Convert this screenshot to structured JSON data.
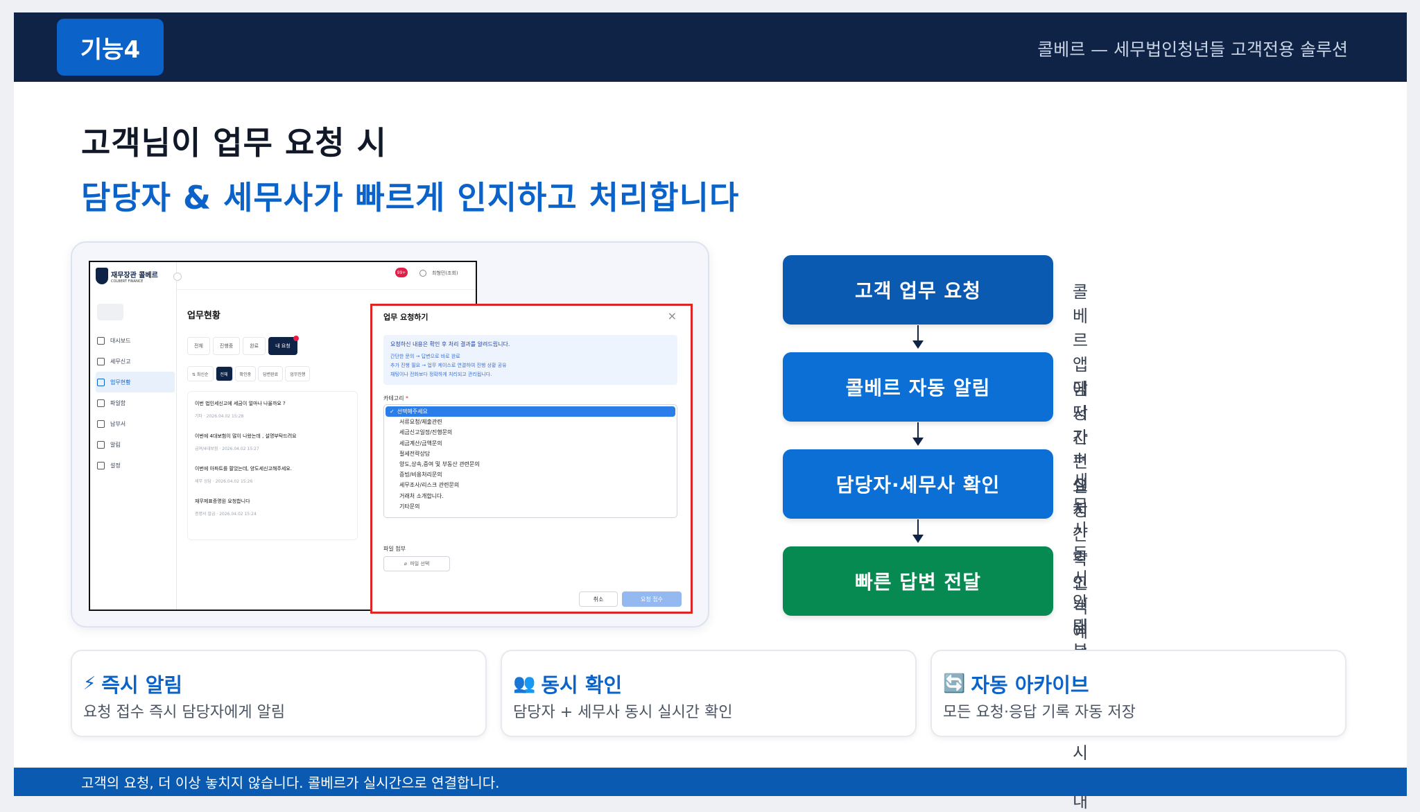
{
  "header": {
    "badge": "기능4",
    "caption": "콜베르 — 세무법인청년들 고객전용 솔루션"
  },
  "headline": {
    "line1": "고객님이 업무 요청 시",
    "line2": "담당자 & 세무사가 빠르게 인지하고 처리합니다"
  },
  "app": {
    "logo_name": "재무장관 콜베르",
    "logo_sub": "COLBERT FINANCE",
    "nav": [
      {
        "label": "대시보드",
        "icon": "grid-icon"
      },
      {
        "label": "세무신고",
        "icon": "document-icon"
      },
      {
        "label": "업무현황",
        "icon": "clipboard-icon"
      },
      {
        "label": "파일함",
        "icon": "folder-icon"
      },
      {
        "label": "납부서",
        "icon": "receipt-icon"
      },
      {
        "label": "알림",
        "icon": "bell-icon"
      },
      {
        "label": "설정",
        "icon": "gear-icon"
      }
    ],
    "active_nav": "업무현황",
    "notification_count": "99+",
    "user": "최형민(조회)",
    "page_title": "업무현황",
    "status_tabs": [
      "전체",
      "진행중",
      "완료",
      "내 요청"
    ],
    "filter_tabs": [
      "⇅ 최신순",
      "전체",
      "확인중",
      "답변완료",
      "업무진행"
    ],
    "requests": [
      {
        "title": "이번 법인세신고에 세금이 얼마나 나올까요 ?",
        "meta": "기타 · 2026.04.02 15:28"
      },
      {
        "title": "이번에 4대보험이 많이 나왔는데 , 설명부탁드려요",
        "meta": "급여/4대보험 · 2026.04.02 15:27"
      },
      {
        "title": "이번에 아파트를 팔았는데, 양도세신고해주세요.",
        "meta": "세무 상담 · 2026.04.02 15:26"
      },
      {
        "title": "재무제표증명원 요청합니다",
        "meta": "증명서 발급 · 2026.04.02 15:24"
      }
    ]
  },
  "modal": {
    "title": "업무 요청하기",
    "info_main": "요청하신 내용은 확인 후 처리 결과를 알려드립니다.",
    "info_lines": [
      "간단한 문의 → 답변으로 바로 완료",
      "추가 진행 필요 → 업무 케이스로 연결하여 진행 상황 공유",
      "채팅이나 전화보다 정확하게 처리되고 관리됩니다."
    ],
    "category_label": "카테고리",
    "required_mark": "*",
    "options": [
      "선택해주세요",
      "서류요청/제출관련",
      "세금신고일정/진행문의",
      "세금계산/금액문의",
      "절세전략상담",
      "양도,상속,증여 및 부동산 관련문의",
      "증빙/비용처리문의",
      "세무조사/리스크 관련문의",
      "거래처 소개합니다.",
      "기타문의"
    ],
    "attach_label": "파일 첨부",
    "attach_button": "파일 선택",
    "cancel": "취소",
    "submit": "요청 접수"
  },
  "flow": {
    "steps": [
      {
        "label": "고객 업무 요청",
        "desc": "콜베르 앱에서 간편 요청",
        "color": "#0b5ab2"
      },
      {
        "label": "콜베르 자동 알림",
        "desc": "담당자 + 세무사 동시 알림",
        "color": "#0b6fd6"
      },
      {
        "label": "담당자·세무사 확인",
        "desc": "실시간 확인 · 내부 검토",
        "color": "#0b6fd6"
      },
      {
        "label": "빠른 답변 전달",
        "desc": "고객에게 결과 즉시 안내",
        "color": "#068a52"
      }
    ]
  },
  "features": [
    {
      "icon": "⚡",
      "icon_name": "lightning-icon",
      "title": "즉시 알림",
      "desc": "요청 접수 즉시 담당자에게 알림"
    },
    {
      "icon": "👥",
      "icon_name": "people-icon",
      "title": "동시 확인",
      "desc": "담당자 + 세무사 동시 실시간 확인"
    },
    {
      "icon": "🔄",
      "icon_name": "refresh-icon",
      "title": "자동 아카이브",
      "desc": "모든 요청·응답 기록 자동 저장"
    }
  ],
  "footer": "고객의 요청, 더 이상 놓치지 않습니다. 콜베르가 실시간으로 연결합니다."
}
